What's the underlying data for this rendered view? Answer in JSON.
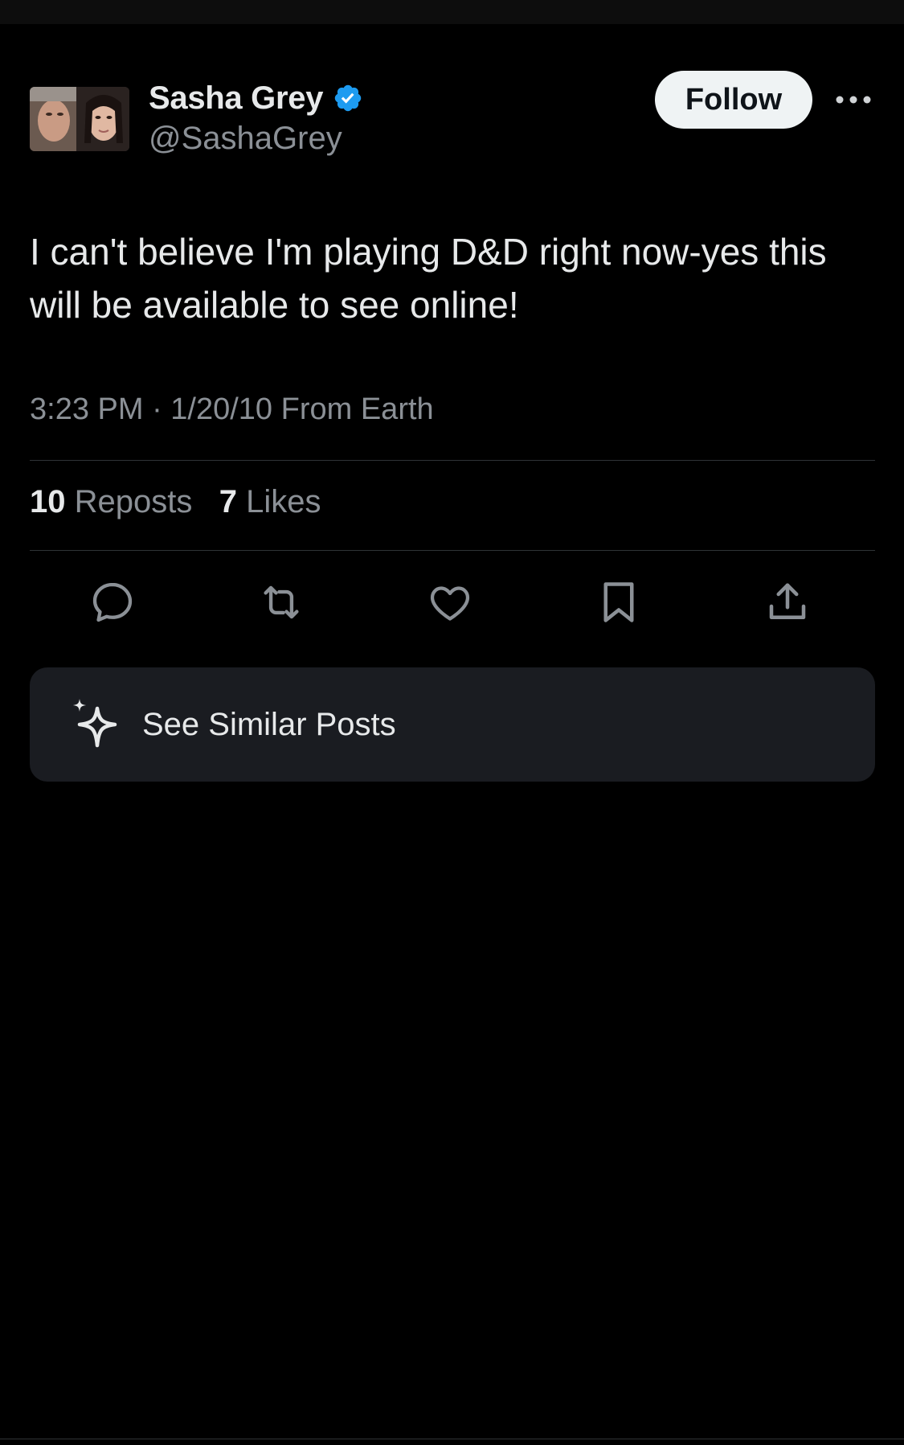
{
  "post": {
    "author": {
      "display_name": "Sasha Grey",
      "handle": "@SashaGrey",
      "verified": true,
      "avatar_icon": "avatar-photo"
    },
    "follow_label": "Follow",
    "text": "I can't believe I'm playing D&D right now-yes this will be available to see online!",
    "meta": "3:23 PM · 1/20/10 From Earth",
    "stats": {
      "reposts_count": "10",
      "reposts_label": "Reposts",
      "likes_count": "7",
      "likes_label": "Likes"
    },
    "actions": [
      {
        "icon": "reply-icon"
      },
      {
        "icon": "repost-icon"
      },
      {
        "icon": "like-icon"
      },
      {
        "icon": "bookmark-icon"
      },
      {
        "icon": "share-icon"
      }
    ]
  },
  "similar": {
    "label": "See Similar Posts",
    "icon": "sparkle-icon"
  },
  "colors": {
    "background": "#000000",
    "text_primary": "#e7e9ea",
    "text_secondary": "#8b9096",
    "verified_blue": "#1d9bf0",
    "card_background": "#1a1c21",
    "divider": "#2f3336",
    "follow_bg": "#eff3f4"
  }
}
